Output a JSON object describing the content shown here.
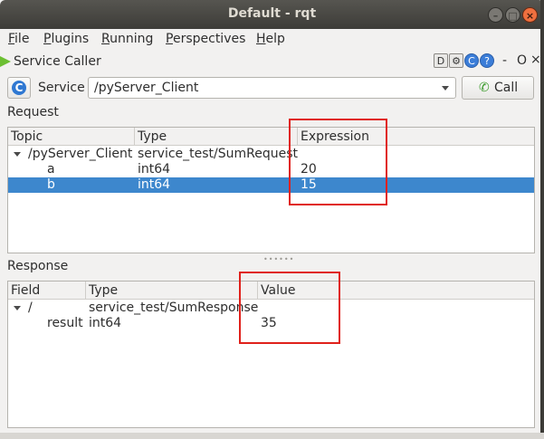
{
  "window": {
    "title": "Default - rqt",
    "min_glyph": "–",
    "max_glyph": "□",
    "close_glyph": "×"
  },
  "menu": {
    "items": [
      {
        "label": "File",
        "u": "F",
        "rest": "ile"
      },
      {
        "label": "Plugins",
        "u": "P",
        "rest": "lugins"
      },
      {
        "label": "Running",
        "u": "R",
        "rest": "unning"
      },
      {
        "label": "Perspectives",
        "u": "P",
        "rest": "erspectives"
      },
      {
        "label": "Help",
        "u": "H",
        "rest": "elp"
      }
    ]
  },
  "plugin": {
    "title": "Service Caller",
    "icon_d": "D",
    "icon_gear": "⚙",
    "icon_refresh": "C",
    "icon_help": "?",
    "dash": "-",
    "o": "O",
    "x": "×"
  },
  "service_row": {
    "label": "Service",
    "selected": "/pyServer_Client",
    "call_label": "Call",
    "call_icon": "✆",
    "refresh_icon": "C"
  },
  "request": {
    "label": "Request",
    "headers": [
      "Topic",
      "Type",
      "Expression"
    ],
    "rows": [
      {
        "topic": "/pyServer_Client",
        "type": "service_test/SumRequest",
        "expr": ""
      },
      {
        "topic": "a",
        "type": "int64",
        "expr": "20"
      },
      {
        "topic": "b",
        "type": "int64",
        "expr": "15"
      }
    ]
  },
  "response": {
    "label": "Response",
    "headers": [
      "Field",
      "Type",
      "Value"
    ],
    "rows": [
      {
        "field": "/",
        "type": "service_test/SumResponse",
        "value": ""
      },
      {
        "field": "result",
        "type": "int64",
        "value": "35"
      }
    ]
  },
  "colors": {
    "selection": "#3d87cd",
    "annotation": "#e0211b",
    "titlebar": "#3d3c38"
  }
}
